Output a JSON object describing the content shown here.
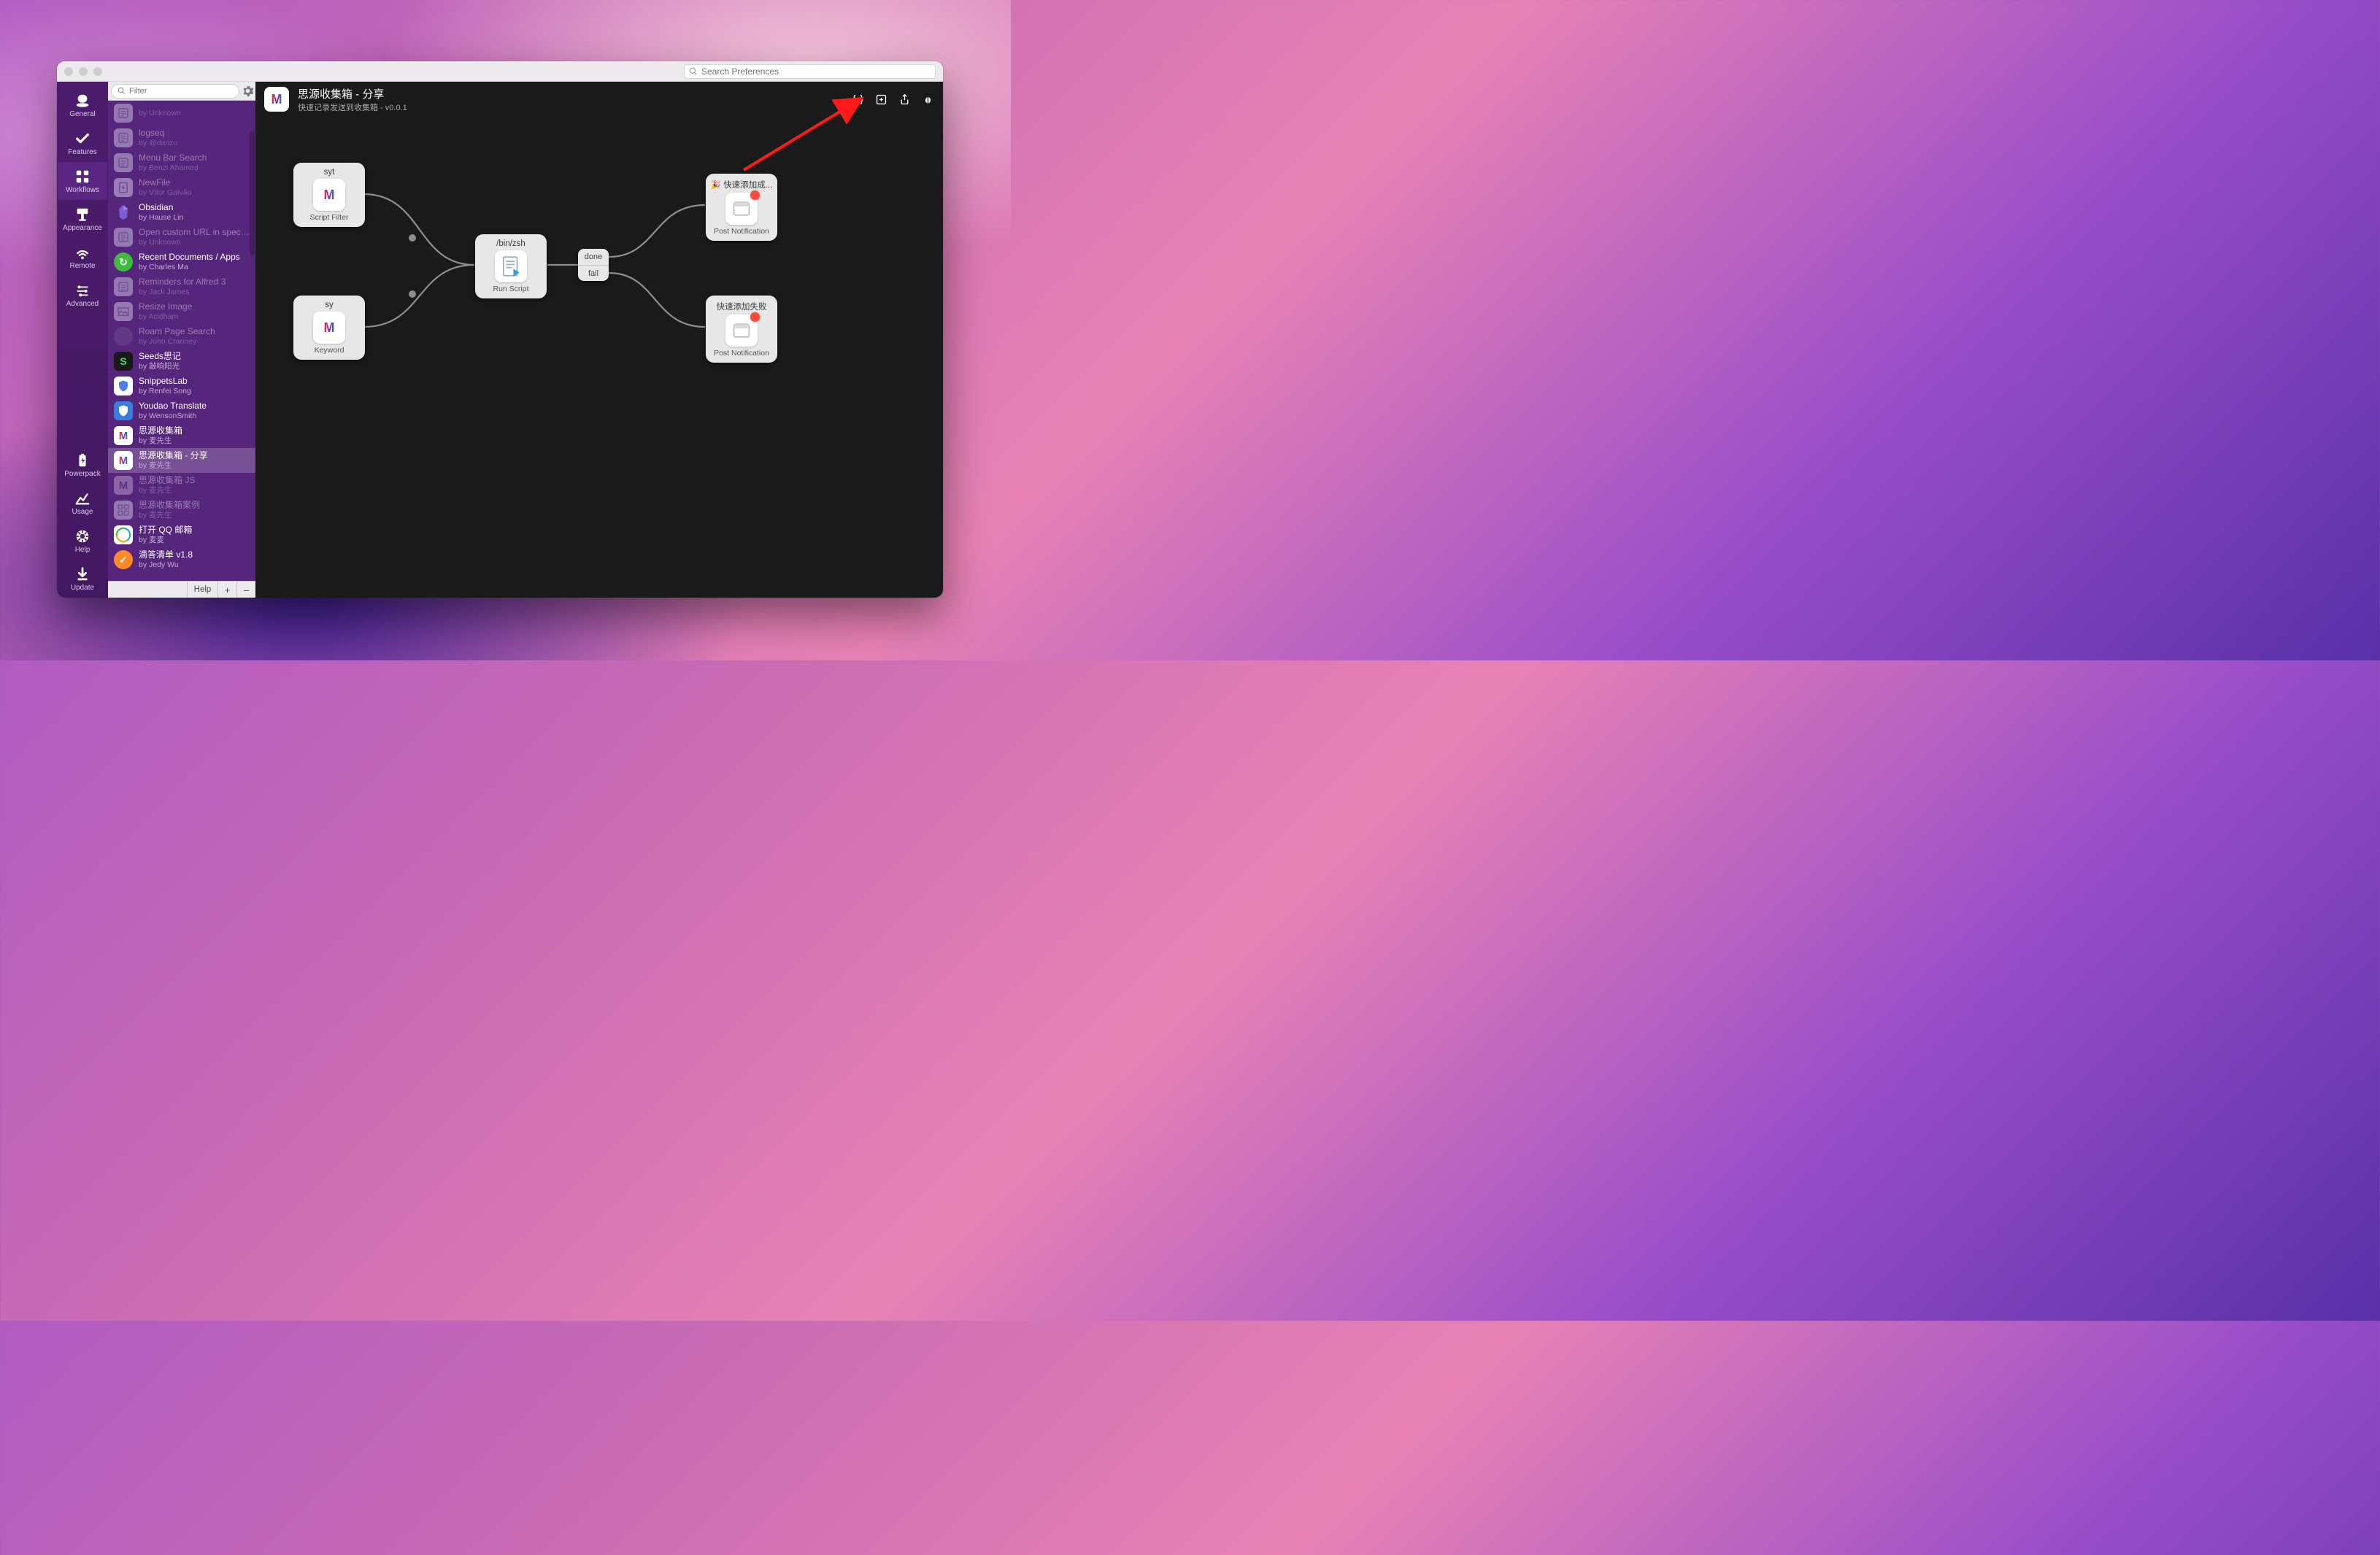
{
  "titlebar": {
    "search_placeholder": "Search Preferences"
  },
  "rail": {
    "items": [
      {
        "id": "general",
        "label": "General"
      },
      {
        "id": "features",
        "label": "Features"
      },
      {
        "id": "workflows",
        "label": "Workflows"
      },
      {
        "id": "appearance",
        "label": "Appearance"
      },
      {
        "id": "remote",
        "label": "Remote"
      },
      {
        "id": "advanced",
        "label": "Advanced"
      }
    ],
    "bottom_items": [
      {
        "id": "powerpack",
        "label": "Powerpack"
      },
      {
        "id": "usage",
        "label": "Usage"
      },
      {
        "id": "help",
        "label": "Help"
      },
      {
        "id": "update",
        "label": "Update"
      }
    ],
    "active": "workflows"
  },
  "list": {
    "filter_placeholder": "Filter",
    "footer": {
      "help": "Help",
      "plus": "+",
      "minus": "–"
    },
    "items": [
      {
        "title": "",
        "author": "by Unknown",
        "dim": true,
        "icon": {
          "type": "box",
          "bg": "#c8bddc",
          "fg": "#7a6a99"
        }
      },
      {
        "title": "logseq",
        "author": "by @danzu",
        "dim": true,
        "icon": {
          "type": "box",
          "bg": "#c8bddc",
          "fg": "#7a6a99"
        }
      },
      {
        "title": "Menu Bar Search",
        "author": "by Benzi Ahamed",
        "dim": true,
        "icon": {
          "type": "box",
          "bg": "#c8bddc",
          "fg": "#7a6a99"
        }
      },
      {
        "title": "NewFile",
        "author": "by Vítor Galvão",
        "dim": true,
        "icon": {
          "type": "plusdoc",
          "bg": "#d0c6e2"
        }
      },
      {
        "title": "Obsidian",
        "author": "by Hause Lin",
        "dim": false,
        "icon": {
          "type": "obsidian"
        }
      },
      {
        "title": "Open custom URL in specifi...",
        "author": "by Unknown",
        "dim": true,
        "icon": {
          "type": "box",
          "bg": "#c8bddc",
          "fg": "#7a6a99"
        }
      },
      {
        "title": "Recent Documents / Apps",
        "author": "by Charles Ma",
        "dim": false,
        "icon": {
          "type": "circle",
          "bg": "#3bbd3b",
          "txt": "↻"
        }
      },
      {
        "title": "Reminders for Alfred 3",
        "author": "by Jack James",
        "dim": true,
        "icon": {
          "type": "box",
          "bg": "#c8bddc",
          "fg": "#7a6a99"
        }
      },
      {
        "title": "Resize Image",
        "author": "by Acidham",
        "dim": true,
        "icon": {
          "type": "img",
          "bg": "#c8bddc"
        }
      },
      {
        "title": "Roam Page Search",
        "author": "by John Cranney",
        "dim": true,
        "icon": {
          "type": "circle",
          "bg": "#6a4a8c",
          "txt": ""
        }
      },
      {
        "title": "Seeds思记",
        "author": "by 敲响阳光",
        "dim": false,
        "icon": {
          "type": "letter",
          "bg": "#1a1a1a",
          "fg": "#4bd964",
          "txt": "S"
        }
      },
      {
        "title": "SnippetsLab",
        "author": "by Renfei Song",
        "dim": false,
        "icon": {
          "type": "shield",
          "bg": "#fff",
          "fg": "#4a80e8"
        }
      },
      {
        "title": "Youdao Translate",
        "author": "by WensonSmith",
        "dim": false,
        "icon": {
          "type": "shield",
          "bg": "#3a7edc",
          "fg": "#fff"
        }
      },
      {
        "title": "思源收集箱",
        "author": "by 麦先生",
        "dim": false,
        "icon": {
          "type": "m"
        }
      },
      {
        "title": "思源收集箱 - 分享",
        "author": "by 麦先生",
        "dim": false,
        "selected": true,
        "icon": {
          "type": "m"
        }
      },
      {
        "title": "思源收集箱 JS",
        "author": "by 麦先生",
        "dim": true,
        "icon": {
          "type": "mdim"
        }
      },
      {
        "title": "思源收集箱案例",
        "author": "by 麦先生",
        "dim": true,
        "icon": {
          "type": "grid",
          "bg": "#c8bddc"
        }
      },
      {
        "title": "打开 QQ 邮箱",
        "author": "by 麦麦",
        "dim": false,
        "icon": {
          "type": "qq"
        }
      },
      {
        "title": "滴答清单 v1.8",
        "author": "by Jedy Wu",
        "dim": false,
        "icon": {
          "type": "circle",
          "bg": "#ff8a2a",
          "txt": "✓"
        }
      }
    ]
  },
  "editor": {
    "header": {
      "title": "思源收集箱 - 分享",
      "subtitle": "快速记录发送到收集箱 - v0.0.1",
      "buttons": [
        "variables",
        "add",
        "share",
        "debug"
      ]
    },
    "nodes": {
      "syt": {
        "tag": "syt",
        "type": "Script Filter"
      },
      "sy": {
        "tag": "sy",
        "type": "Keyword"
      },
      "run": {
        "tag": "/bin/zsh",
        "type": "Run Script"
      },
      "post1": {
        "tag": "🎉 快速添加成...",
        "type": "Post Notification"
      },
      "post2": {
        "tag": "快速添加失败",
        "type": "Post Notification"
      }
    },
    "branch": {
      "done": "done",
      "fail": "fail"
    }
  }
}
